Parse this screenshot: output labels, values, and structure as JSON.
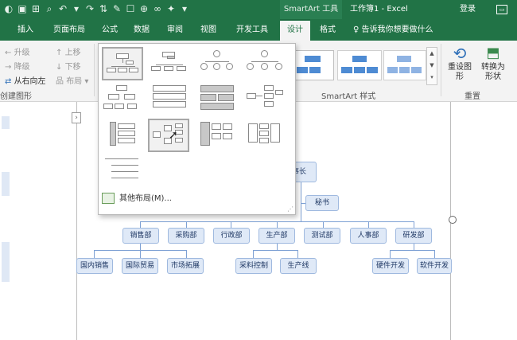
{
  "window": {
    "context_title": "SmartArt 工具",
    "doc_title": "工作簿1 - Excel",
    "login": "登录"
  },
  "tabs": [
    "插入",
    "页面布局",
    "公式",
    "数据",
    "审阅",
    "视图",
    "开发工具",
    "设计",
    "格式"
  ],
  "active_tab": "设计",
  "tell_me": "告诉我你想要做什么",
  "ribbon": {
    "create": {
      "promote": "升级",
      "demote": "降级",
      "rtl": "从右向左",
      "move_up": "上移",
      "move_down": "下移",
      "layout": "布局",
      "group_label": "创建图形"
    },
    "styles_label": "SmartArt 样式",
    "reset": {
      "reset_graphic": "重设图形",
      "convert": "转换为",
      "convert2": "形状",
      "group_label": "重置"
    }
  },
  "gallery": {
    "more_layouts": "其他布局(M)..."
  },
  "org_chart": {
    "top_partial": "事长",
    "assistant": "秘书",
    "departments": [
      "销售部",
      "采购部",
      "行政部",
      "生产部",
      "测试部",
      "人事部",
      "研发部"
    ],
    "sales_children": [
      "国内销售",
      "国际贸易",
      "市场拓展"
    ],
    "production_children": [
      "采料控制",
      "生产线"
    ],
    "rnd_children": [
      "硬件开发",
      "软件开发"
    ]
  },
  "colors": {
    "excel_green": "#217346",
    "node_fill": "#dfe9f7",
    "node_border": "#9fb9df",
    "style_blue": "#4e8bd3"
  }
}
